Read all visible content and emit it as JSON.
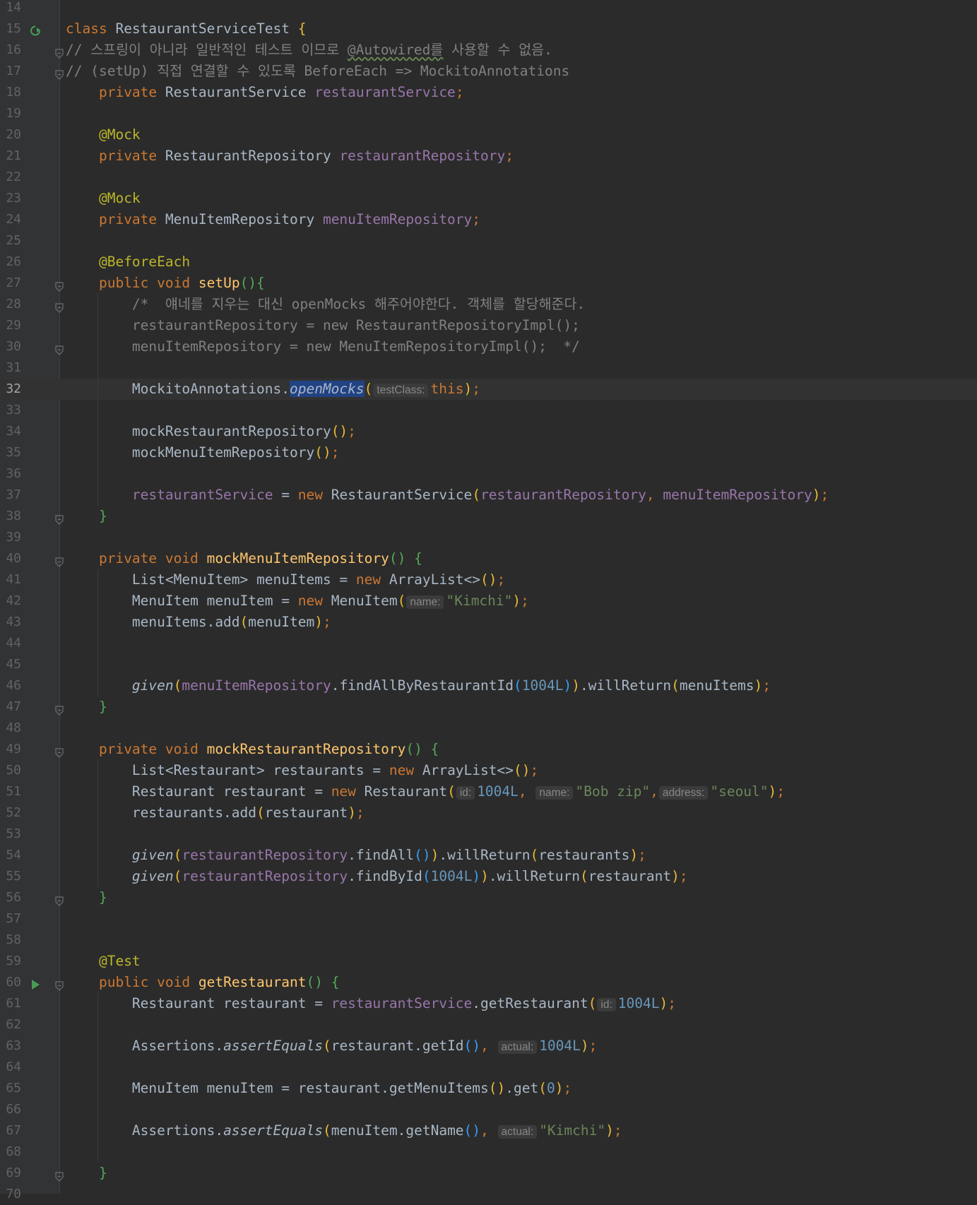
{
  "editor": {
    "current_line": 32,
    "lines": [
      {
        "n": "14",
        "t": []
      },
      {
        "n": "15",
        "icon": "run-class",
        "t": [
          [
            "kw",
            "class "
          ],
          [
            "",
            "RestaurantServiceTest "
          ],
          [
            "br1",
            "{"
          ]
        ]
      },
      {
        "n": "16",
        "fold": true,
        "t": [
          [
            "cm",
            "// 스프링이 아니라 일반적인 테스트 이므로 "
          ],
          [
            "cm und",
            "@Autowired를"
          ],
          [
            "cm",
            " 사용할 수 없음."
          ]
        ]
      },
      {
        "n": "17",
        "fold": true,
        "t": [
          [
            "cm",
            "// (setUp) 직접 연결할 수 있도록 BeforeEach => MockitoAnnotations"
          ]
        ]
      },
      {
        "n": "18",
        "t": [
          [
            "",
            "    "
          ],
          [
            "kw",
            "private "
          ],
          [
            "",
            "RestaurantService "
          ],
          [
            "fld",
            "restaurantService"
          ],
          [
            "kw",
            ";"
          ]
        ]
      },
      {
        "n": "19",
        "t": []
      },
      {
        "n": "20",
        "t": [
          [
            "",
            "    "
          ],
          [
            "an",
            "@Mock"
          ]
        ]
      },
      {
        "n": "21",
        "t": [
          [
            "",
            "    "
          ],
          [
            "kw",
            "private "
          ],
          [
            "",
            "RestaurantRepository "
          ],
          [
            "fld",
            "restaurantRepository"
          ],
          [
            "kw",
            ";"
          ]
        ]
      },
      {
        "n": "22",
        "t": []
      },
      {
        "n": "23",
        "t": [
          [
            "",
            "    "
          ],
          [
            "an",
            "@Mock"
          ]
        ]
      },
      {
        "n": "24",
        "t": [
          [
            "",
            "    "
          ],
          [
            "kw",
            "private "
          ],
          [
            "",
            "MenuItemRepository "
          ],
          [
            "fld",
            "menuItemRepository"
          ],
          [
            "kw",
            ";"
          ]
        ]
      },
      {
        "n": "25",
        "t": []
      },
      {
        "n": "26",
        "t": [
          [
            "",
            "    "
          ],
          [
            "an",
            "@BeforeEach"
          ]
        ]
      },
      {
        "n": "27",
        "fold": true,
        "t": [
          [
            "",
            "    "
          ],
          [
            "kw",
            "public void "
          ],
          [
            "fn",
            "setUp"
          ],
          [
            "br2",
            "()"
          ],
          [
            "br2",
            "{"
          ]
        ]
      },
      {
        "n": "28",
        "fold": true,
        "g": 1,
        "t": [
          [
            "",
            "        "
          ],
          [
            "cm",
            "/*  얘네를 지우는 대신 openMocks 해주어야한다. 객체를 할당해준다."
          ]
        ]
      },
      {
        "n": "29",
        "g": 1,
        "t": [
          [
            "",
            "        "
          ],
          [
            "cm",
            "restaurantRepository = new RestaurantRepositoryImpl();"
          ]
        ]
      },
      {
        "n": "30",
        "fold": true,
        "g": 1,
        "t": [
          [
            "",
            "        "
          ],
          [
            "cm",
            "menuItemRepository = new MenuItemRepositoryImpl();  */"
          ]
        ]
      },
      {
        "n": "31",
        "g": 1,
        "t": []
      },
      {
        "n": "32",
        "g": 1,
        "t": [
          [
            "",
            "        MockitoAnnotations."
          ],
          [
            "it sel",
            "openMocks"
          ],
          [
            "br1",
            "("
          ],
          [
            "hint",
            "testClass:"
          ],
          [
            "kw",
            "this"
          ],
          [
            "br1",
            ")"
          ],
          [
            "kw",
            ";"
          ]
        ]
      },
      {
        "n": "33",
        "g": 1,
        "t": []
      },
      {
        "n": "34",
        "g": 1,
        "t": [
          [
            "",
            "        mockRestaurantRepository"
          ],
          [
            "br1",
            "()"
          ],
          [
            "kw",
            ";"
          ]
        ]
      },
      {
        "n": "35",
        "g": 1,
        "t": [
          [
            "",
            "        mockMenuItemRepository"
          ],
          [
            "br1",
            "()"
          ],
          [
            "kw",
            ";"
          ]
        ]
      },
      {
        "n": "36",
        "g": 1,
        "t": []
      },
      {
        "n": "37",
        "g": 1,
        "t": [
          [
            "",
            "        "
          ],
          [
            "fld",
            "restaurantService"
          ],
          [
            "",
            " = "
          ],
          [
            "kw",
            "new "
          ],
          [
            "",
            "RestaurantService"
          ],
          [
            "br1",
            "("
          ],
          [
            "fld",
            "restaurantRepository"
          ],
          [
            "kw",
            ", "
          ],
          [
            "fld",
            "menuItemRepository"
          ],
          [
            "br1",
            ")"
          ],
          [
            "kw",
            ";"
          ]
        ]
      },
      {
        "n": "38",
        "fold": true,
        "t": [
          [
            "",
            "    "
          ],
          [
            "br2",
            "}"
          ]
        ]
      },
      {
        "n": "39",
        "t": []
      },
      {
        "n": "40",
        "fold": true,
        "t": [
          [
            "",
            "    "
          ],
          [
            "kw",
            "private void "
          ],
          [
            "fn",
            "mockMenuItemRepository"
          ],
          [
            "br2",
            "() "
          ],
          [
            "br2",
            "{"
          ]
        ]
      },
      {
        "n": "41",
        "g": 1,
        "t": [
          [
            "",
            "        List<MenuItem> menuItems = "
          ],
          [
            "kw",
            "new "
          ],
          [
            "",
            "ArrayList<>"
          ],
          [
            "br1",
            "()"
          ],
          [
            "kw",
            ";"
          ]
        ]
      },
      {
        "n": "42",
        "g": 1,
        "t": [
          [
            "",
            "        MenuItem menuItem = "
          ],
          [
            "kw",
            "new "
          ],
          [
            "",
            "MenuItem"
          ],
          [
            "br1",
            "("
          ],
          [
            "hint",
            "name:"
          ],
          [
            "str",
            "\"Kimchi\""
          ],
          [
            "br1",
            ")"
          ],
          [
            "kw",
            ";"
          ]
        ]
      },
      {
        "n": "43",
        "g": 1,
        "t": [
          [
            "",
            "        menuItems.add"
          ],
          [
            "br1",
            "("
          ],
          [
            "",
            "menuItem"
          ],
          [
            "br1",
            ")"
          ],
          [
            "kw",
            ";"
          ]
        ]
      },
      {
        "n": "44",
        "g": 1,
        "t": []
      },
      {
        "n": "45",
        "g": 1,
        "t": []
      },
      {
        "n": "46",
        "g": 1,
        "t": [
          [
            "",
            "        "
          ],
          [
            "it",
            "given"
          ],
          [
            "br1",
            "("
          ],
          [
            "fld",
            "menuItemRepository"
          ],
          [
            "",
            ".findAllByRestaurantId"
          ],
          [
            "br3",
            "("
          ],
          [
            "num",
            "1004L"
          ],
          [
            "br3",
            ")"
          ],
          [
            "br1",
            ")"
          ],
          [
            "",
            ".willReturn"
          ],
          [
            "br1",
            "("
          ],
          [
            "",
            "menuItems"
          ],
          [
            "br1",
            ")"
          ],
          [
            "kw",
            ";"
          ]
        ]
      },
      {
        "n": "47",
        "fold": true,
        "t": [
          [
            "",
            "    "
          ],
          [
            "br2",
            "}"
          ]
        ]
      },
      {
        "n": "48",
        "t": []
      },
      {
        "n": "49",
        "fold": true,
        "t": [
          [
            "",
            "    "
          ],
          [
            "kw",
            "private void "
          ],
          [
            "fn",
            "mockRestaurantRepository"
          ],
          [
            "br2",
            "() "
          ],
          [
            "br2",
            "{"
          ]
        ]
      },
      {
        "n": "50",
        "g": 1,
        "t": [
          [
            "",
            "        List<Restaurant> restaurants = "
          ],
          [
            "kw",
            "new "
          ],
          [
            "",
            "ArrayList<>"
          ],
          [
            "br1",
            "()"
          ],
          [
            "kw",
            ";"
          ]
        ]
      },
      {
        "n": "51",
        "g": 1,
        "t": [
          [
            "",
            "        Restaurant restaurant = "
          ],
          [
            "kw",
            "new "
          ],
          [
            "",
            "Restaurant"
          ],
          [
            "br1",
            "("
          ],
          [
            "hint",
            "id:"
          ],
          [
            "num",
            "1004L"
          ],
          [
            "kw",
            ", "
          ],
          [
            "hint",
            "name:"
          ],
          [
            "str",
            "\"Bob zip\""
          ],
          [
            "kw",
            ","
          ],
          [
            "hint",
            "address:"
          ],
          [
            "str",
            "\"seoul\""
          ],
          [
            "br1",
            ")"
          ],
          [
            "kw",
            ";"
          ]
        ]
      },
      {
        "n": "52",
        "g": 1,
        "t": [
          [
            "",
            "        restaurants.add"
          ],
          [
            "br1",
            "("
          ],
          [
            "",
            "restaurant"
          ],
          [
            "br1",
            ")"
          ],
          [
            "kw",
            ";"
          ]
        ]
      },
      {
        "n": "53",
        "g": 1,
        "t": []
      },
      {
        "n": "54",
        "g": 1,
        "t": [
          [
            "",
            "        "
          ],
          [
            "it",
            "given"
          ],
          [
            "br1",
            "("
          ],
          [
            "fld",
            "restaurantRepository"
          ],
          [
            "",
            ".findAll"
          ],
          [
            "br3",
            "()"
          ],
          [
            "br1",
            ")"
          ],
          [
            "",
            ".willReturn"
          ],
          [
            "br1",
            "("
          ],
          [
            "",
            "restaurants"
          ],
          [
            "br1",
            ")"
          ],
          [
            "kw",
            ";"
          ]
        ]
      },
      {
        "n": "55",
        "g": 1,
        "t": [
          [
            "",
            "        "
          ],
          [
            "it",
            "given"
          ],
          [
            "br1",
            "("
          ],
          [
            "fld",
            "restaurantRepository"
          ],
          [
            "",
            ".findById"
          ],
          [
            "br3",
            "("
          ],
          [
            "num",
            "1004L"
          ],
          [
            "br3",
            ")"
          ],
          [
            "br1",
            ")"
          ],
          [
            "",
            ".willReturn"
          ],
          [
            "br1",
            "("
          ],
          [
            "",
            "restaurant"
          ],
          [
            "br1",
            ")"
          ],
          [
            "kw",
            ";"
          ]
        ]
      },
      {
        "n": "56",
        "fold": true,
        "t": [
          [
            "",
            "    "
          ],
          [
            "br2",
            "}"
          ]
        ]
      },
      {
        "n": "57",
        "t": []
      },
      {
        "n": "58",
        "t": []
      },
      {
        "n": "59",
        "t": [
          [
            "",
            "    "
          ],
          [
            "an",
            "@Test"
          ]
        ]
      },
      {
        "n": "60",
        "icon": "run-test",
        "fold": true,
        "t": [
          [
            "",
            "    "
          ],
          [
            "kw",
            "public void "
          ],
          [
            "fn",
            "getRestaurant"
          ],
          [
            "br2",
            "() "
          ],
          [
            "br2",
            "{"
          ]
        ]
      },
      {
        "n": "61",
        "g": 1,
        "t": [
          [
            "",
            "        Restaurant restaurant = "
          ],
          [
            "fld",
            "restaurantService"
          ],
          [
            "",
            ".getRestaurant"
          ],
          [
            "br1",
            "("
          ],
          [
            "hint",
            "id:"
          ],
          [
            "num",
            "1004L"
          ],
          [
            "br1",
            ")"
          ],
          [
            "kw",
            ";"
          ]
        ]
      },
      {
        "n": "62",
        "g": 1,
        "t": []
      },
      {
        "n": "63",
        "g": 1,
        "t": [
          [
            "",
            "        Assertions."
          ],
          [
            "it",
            "assertEquals"
          ],
          [
            "br1",
            "("
          ],
          [
            "",
            "restaurant.getId"
          ],
          [
            "br3",
            "()"
          ],
          [
            "kw",
            ", "
          ],
          [
            "hint",
            "actual:"
          ],
          [
            "num",
            "1004L"
          ],
          [
            "br1",
            ")"
          ],
          [
            "kw",
            ";"
          ]
        ]
      },
      {
        "n": "64",
        "g": 1,
        "t": []
      },
      {
        "n": "65",
        "g": 1,
        "t": [
          [
            "",
            "        MenuItem menuItem = restaurant.getMenuItems"
          ],
          [
            "br1",
            "()"
          ],
          [
            "",
            ".get"
          ],
          [
            "br1",
            "("
          ],
          [
            "num",
            "0"
          ],
          [
            "br1",
            ")"
          ],
          [
            "kw",
            ";"
          ]
        ]
      },
      {
        "n": "66",
        "g": 1,
        "t": []
      },
      {
        "n": "67",
        "g": 1,
        "t": [
          [
            "",
            "        Assertions."
          ],
          [
            "it",
            "assertEquals"
          ],
          [
            "br1",
            "("
          ],
          [
            "",
            "menuItem.getName"
          ],
          [
            "br3",
            "()"
          ],
          [
            "kw",
            ", "
          ],
          [
            "hint",
            "actual:"
          ],
          [
            "str",
            "\"Kimchi\""
          ],
          [
            "br1",
            ")"
          ],
          [
            "kw",
            ";"
          ]
        ]
      },
      {
        "n": "68",
        "g": 1,
        "t": []
      },
      {
        "n": "69",
        "fold": true,
        "t": [
          [
            "",
            "    "
          ],
          [
            "br2",
            "}"
          ]
        ]
      },
      {
        "n": "70",
        "t": []
      }
    ]
  }
}
